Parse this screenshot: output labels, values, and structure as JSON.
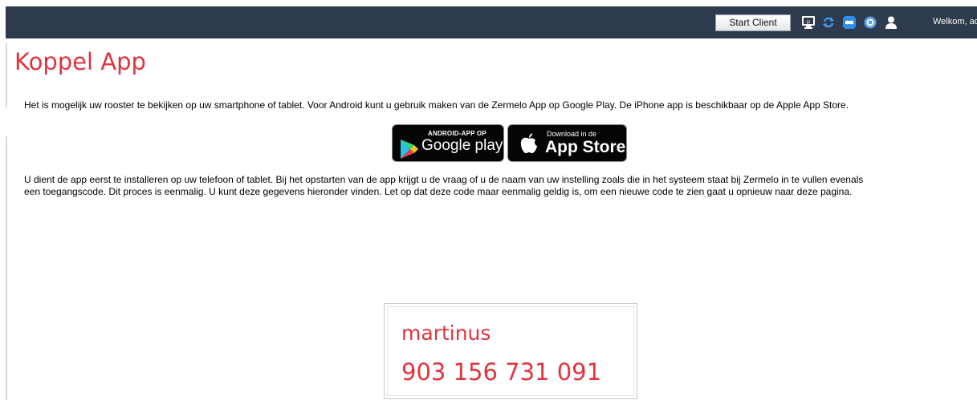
{
  "header": {
    "start_client_label": "Start Client",
    "welcome_text": "Welkom, admin",
    "icons": [
      "monitor-icon",
      "refresh-icon",
      "chat-icon",
      "help-icon",
      "user-icon"
    ],
    "background_color": "#2e3a4d"
  },
  "page": {
    "title": "Koppel App",
    "intro_text": "Het is mogelijk uw rooster te bekijken op uw smartphone of tablet. Voor Android kunt u gebruik maken van de Zermelo App op Google Play. De iPhone app is beschikbaar op de Apple App Store.",
    "instructions_line1": "U dient de app eerst te installeren op uw telefoon of tablet. Bij het opstarten van de app krijgt u de vraag of u de naam van uw instelling zoals die in het systeem staat bij Zermelo in te vullen evenals",
    "instructions_line2": "een toegangscode. Dit proces is eenmalig. U kunt deze gegevens hieronder vinden. Let op dat deze code maar eenmalig geldig is, om een nieuwe code te zien gaat u opnieuw naar deze pagina.",
    "accent_color": "#e0343e"
  },
  "badges": {
    "google_play": {
      "top": "ANDROID-APP OP",
      "bottom": "Google play"
    },
    "app_store": {
      "top": "Download in de",
      "bottom": "App Store"
    }
  },
  "code_box": {
    "institution": "martinus",
    "code": "903 156 731 091"
  }
}
